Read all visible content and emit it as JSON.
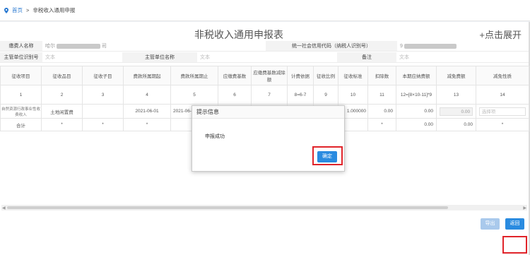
{
  "breadcrumb": {
    "home": "首页",
    "separator": ">",
    "current": "非税收入通用申报"
  },
  "page": {
    "title": "非税收入通用申报表",
    "expand": "+点击展开"
  },
  "form": {
    "payer_name_label": "缴费人名称",
    "payer_name_value": "哈尔",
    "payer_name_suffix": "司",
    "credit_code_label": "统一社会信用代码（纳税人识别号）",
    "credit_code_value": "9",
    "org_code_label": "主管单位识别号",
    "org_code_placeholder": "文本",
    "org_name_label": "主管单位名称",
    "org_name_placeholder": "文本",
    "remark_label": "备注",
    "remark_placeholder": "文本"
  },
  "table": {
    "headers": [
      "征收项目",
      "征收品目",
      "征收子目",
      "费款所属期起",
      "费款所属期止",
      "应缴费基数",
      "应缴费基数减除额",
      "计费依据",
      "征收比例",
      "征收标准",
      "扣除数",
      "本期应纳费额",
      "减免费额",
      "减免性质"
    ],
    "numbers": [
      "1",
      "2",
      "3",
      "4",
      "5",
      "6",
      "7",
      "8=6-7",
      "9",
      "10",
      "11",
      "12=[8×10-11]*9",
      "13",
      "14"
    ],
    "row": [
      "自然资源行政事业性收费收入",
      "土地闲置费",
      "",
      "2021-06-01",
      "2021-06-3",
      "",
      "",
      "",
      "",
      "1.000000",
      "0.00",
      "0.00",
      "0.00",
      "选择项"
    ],
    "total": [
      "合计",
      "*",
      "*",
      "*",
      "*",
      "",
      "",
      "",
      "",
      "",
      "*",
      "0.00",
      "0.00",
      "*"
    ]
  },
  "dialog": {
    "title": "提示信息",
    "message": "申报成功",
    "ok": "确定"
  },
  "buttons": {
    "export": "导出",
    "back": "返回"
  },
  "colors": {
    "primary": "#2a8be0",
    "highlight": "#e0242a"
  }
}
